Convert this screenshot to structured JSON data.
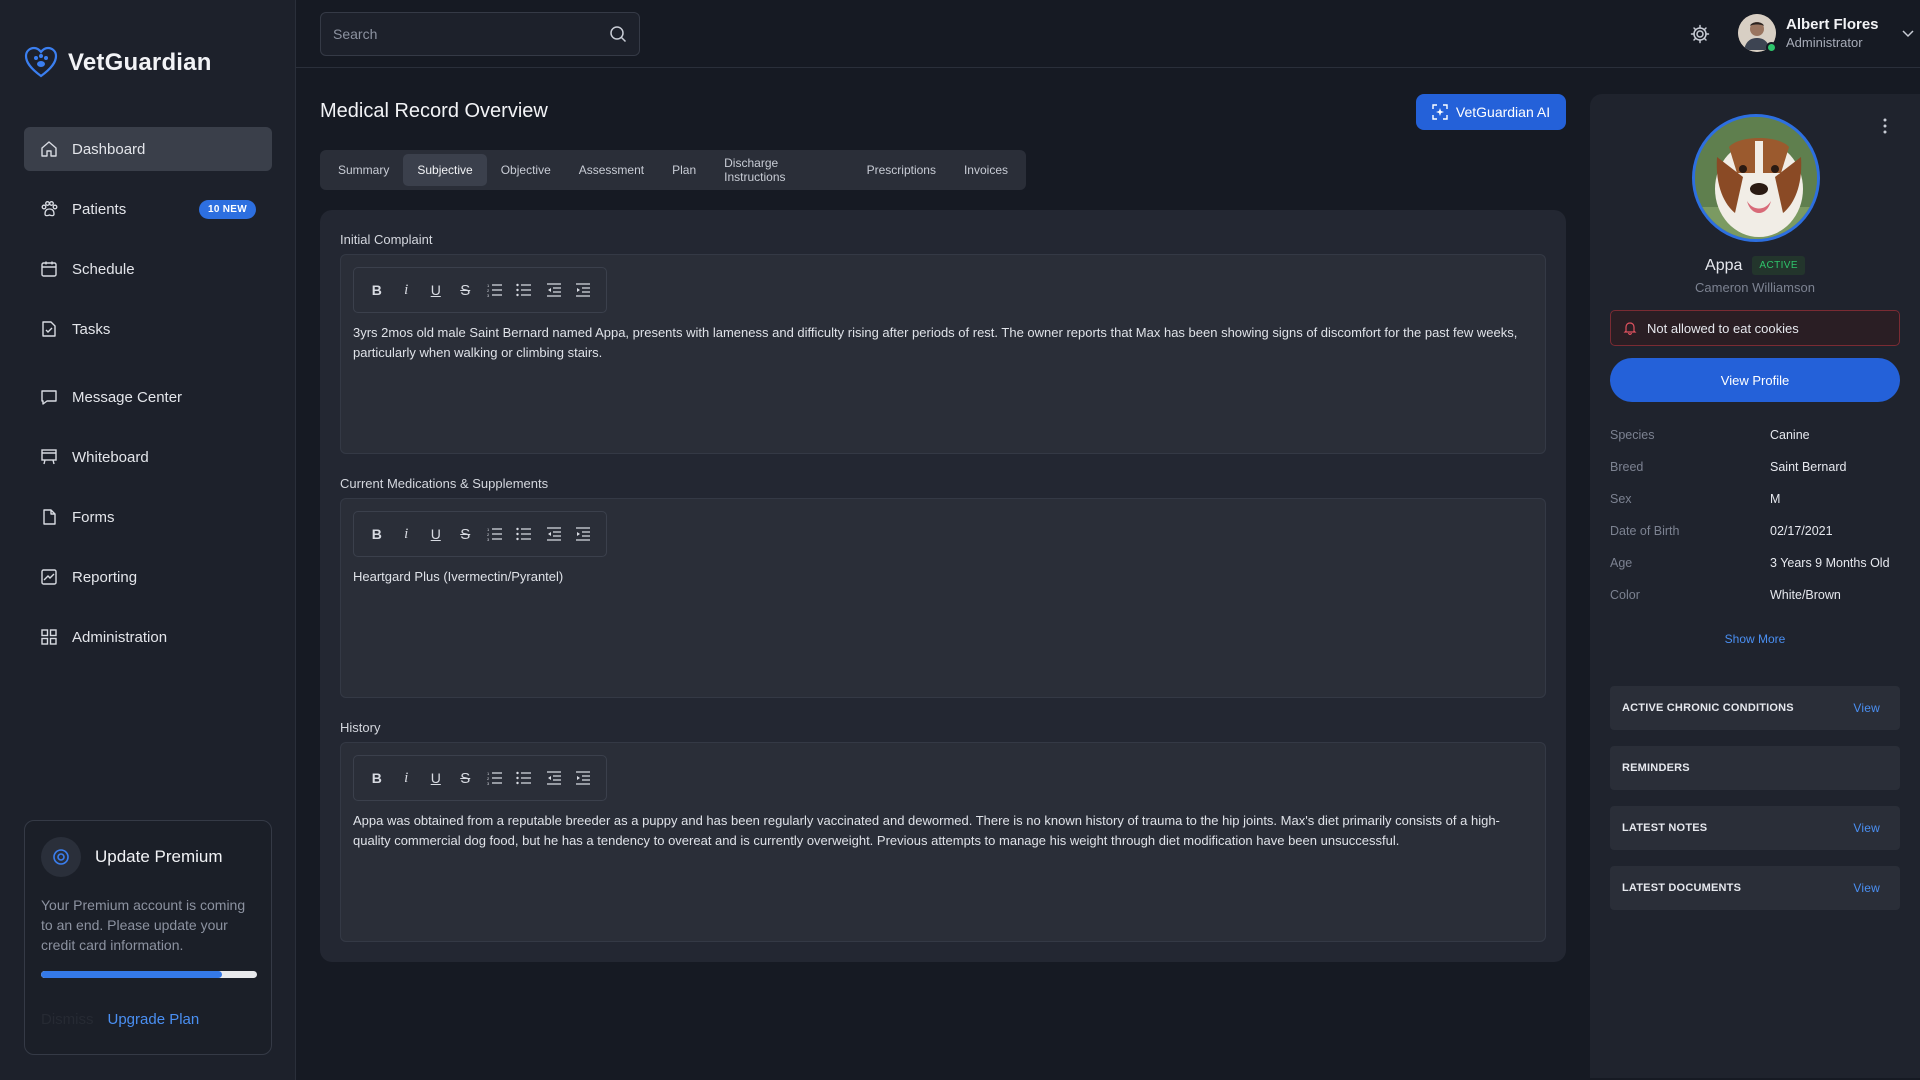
{
  "app": {
    "name": "VetGuardian"
  },
  "sidebar": {
    "items": [
      {
        "label": "Dashboard",
        "icon": "home-icon"
      },
      {
        "label": "Patients",
        "icon": "paw-icon",
        "badge": "10 NEW"
      },
      {
        "label": "Schedule",
        "icon": "calendar-icon"
      },
      {
        "label": "Tasks",
        "icon": "tasks-icon"
      },
      {
        "label": "Message Center",
        "icon": "message-icon"
      },
      {
        "label": "Whiteboard",
        "icon": "whiteboard-icon"
      },
      {
        "label": "Forms",
        "icon": "file-icon"
      },
      {
        "label": "Reporting",
        "icon": "chart-icon"
      },
      {
        "label": "Administration",
        "icon": "grid-icon"
      }
    ],
    "active_index": 0,
    "premium": {
      "title": "Update Premium",
      "description": "Your Premium account is coming to an end. Please update your credit card information.",
      "progress_percent": 84,
      "dismiss_label": "Dismiss",
      "upgrade_label": "Upgrade Plan"
    }
  },
  "header": {
    "search_placeholder": "Search",
    "user": {
      "name": "Albert Flores",
      "role": "Administrator"
    }
  },
  "main": {
    "title": "Medical Record Overview",
    "ai_button_label": "VetGuardian AI",
    "tabs": [
      {
        "label": "Summary"
      },
      {
        "label": "Subjective"
      },
      {
        "label": "Objective"
      },
      {
        "label": "Assessment"
      },
      {
        "label": "Plan"
      },
      {
        "label": "Discharge Instructions"
      },
      {
        "label": "Prescriptions"
      },
      {
        "label": "Invoices"
      }
    ],
    "active_tab_index": 1,
    "sections": [
      {
        "label": "Initial Complaint",
        "text": "3yrs 2mos old male Saint Bernard named Appa, presents with lameness and difficulty rising after periods of rest. The owner reports that Max has been showing signs of discomfort for the past few weeks, particularly when walking or climbing stairs."
      },
      {
        "label": "Current Medications & Supplements",
        "text": "Heartgard Plus (Ivermectin/Pyrantel)"
      },
      {
        "label": "History",
        "text": "Appa was obtained from a reputable breeder as a puppy and has been regularly vaccinated and dewormed. There is no known history of trauma to the hip joints. Max's diet primarily consists of a high-quality commercial dog food, but he has a tendency to overeat and is currently overweight. Previous attempts to manage his weight through diet modification have been unsuccessful."
      }
    ]
  },
  "patient_panel": {
    "name": "Appa",
    "status": "ACTIVE",
    "owner": "Cameron Williamson",
    "alert": "Not allowed to eat cookies",
    "view_profile_label": "View Profile",
    "details": [
      {
        "label": "Species",
        "value": "Canine"
      },
      {
        "label": "Breed",
        "value": "Saint Bernard"
      },
      {
        "label": "Sex",
        "value": "M"
      },
      {
        "label": "Date of Birth",
        "value": "02/17/2021"
      },
      {
        "label": "Age",
        "value": "3 Years 9 Months Old"
      },
      {
        "label": "Color",
        "value": "White/Brown"
      }
    ],
    "show_more_label": "Show More",
    "accordions": [
      {
        "title": "ACTIVE CHRONIC CONDITIONS",
        "action": "View"
      },
      {
        "title": "REMINDERS",
        "action": ""
      },
      {
        "title": "LATEST NOTES",
        "action": "View"
      },
      {
        "title": "LATEST DOCUMENTS",
        "action": "View"
      }
    ]
  },
  "colors": {
    "accent": "#2461d9",
    "background": "#161a23",
    "active_green": "#2ec46b",
    "alert_border": "#7a2b33"
  }
}
